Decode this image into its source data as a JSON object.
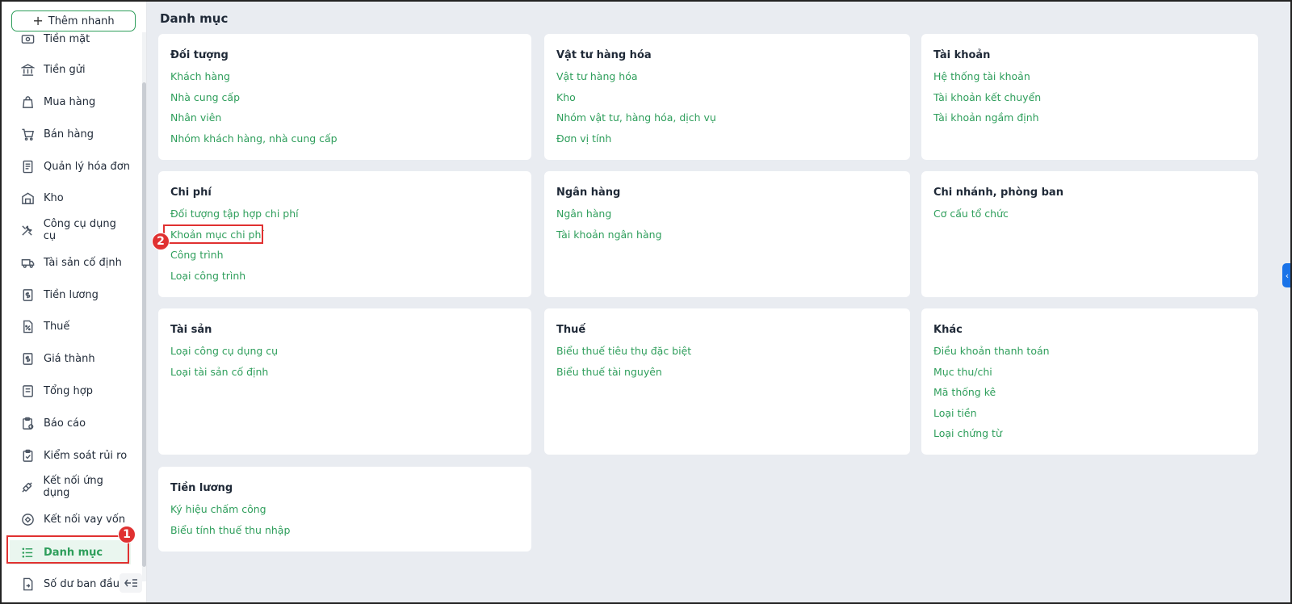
{
  "sidebar": {
    "quick_add_label": "Thêm nhanh",
    "items": [
      {
        "label": "Tiền mặt",
        "icon": "cash-icon"
      },
      {
        "label": "Tiền gửi",
        "icon": "bank-icon"
      },
      {
        "label": "Mua hàng",
        "icon": "bag-icon"
      },
      {
        "label": "Bán hàng",
        "icon": "cart-icon"
      },
      {
        "label": "Quản lý hóa đơn",
        "icon": "invoice-icon"
      },
      {
        "label": "Kho",
        "icon": "warehouse-icon"
      },
      {
        "label": "Công cụ dụng cụ",
        "icon": "tools-icon"
      },
      {
        "label": "Tài sản cố định",
        "icon": "truck-icon"
      },
      {
        "label": "Tiền lương",
        "icon": "salary-icon"
      },
      {
        "label": "Thuế",
        "icon": "tax-icon"
      },
      {
        "label": "Giá thành",
        "icon": "cost-icon"
      },
      {
        "label": "Tổng hợp",
        "icon": "summary-icon"
      },
      {
        "label": "Báo cáo",
        "icon": "report-icon"
      },
      {
        "label": "Kiểm soát rủi ro",
        "icon": "risk-icon"
      },
      {
        "label": "Kết nối ứng dụng",
        "icon": "connect-icon"
      },
      {
        "label": "Kết nối vay vốn",
        "icon": "loan-icon"
      },
      {
        "label": "Danh mục",
        "icon": "list-icon",
        "active": true
      },
      {
        "label": "Số dư ban đầu",
        "icon": "balance-icon"
      }
    ]
  },
  "main": {
    "title": "Danh mục",
    "cards": [
      {
        "title": "Đối tượng",
        "links": [
          "Khách hàng",
          "Nhà cung cấp",
          "Nhân viên",
          "Nhóm khách hàng, nhà cung cấp"
        ]
      },
      {
        "title": "Vật tư hàng hóa",
        "links": [
          "Vật tư hàng hóa",
          "Kho",
          "Nhóm vật tư, hàng hóa, dịch vụ",
          "Đơn vị tính"
        ]
      },
      {
        "title": "Tài khoản",
        "links": [
          "Hệ thống tài khoản",
          "Tài khoản kết chuyển",
          "Tài khoản ngầm định"
        ]
      },
      {
        "title": "Chi phí",
        "links": [
          "Đối tượng tập hợp chi phí",
          "Khoản mục chi phí",
          "Công trình",
          "Loại công trình"
        ]
      },
      {
        "title": "Ngân hàng",
        "links": [
          "Ngân hàng",
          "Tài khoản ngân hàng"
        ]
      },
      {
        "title": "Chi nhánh, phòng ban",
        "links": [
          "Cơ cấu tổ chức"
        ]
      },
      {
        "title": "Tài sản",
        "links": [
          "Loại công cụ dụng cụ",
          "Loại tài sản cố định"
        ]
      },
      {
        "title": "Thuế",
        "links": [
          "Biểu thuế tiêu thụ đặc biệt",
          "Biểu thuế tài nguyên"
        ]
      },
      {
        "title": "Khác",
        "links": [
          "Điều khoản thanh toán",
          "Mục thu/chi",
          "Mã thống kê",
          "Loại tiền",
          "Loại chứng từ"
        ]
      },
      {
        "title": "Tiền lương",
        "links": [
          "Ký hiệu chấm công",
          "Biểu tính thuế thu nhập"
        ]
      }
    ]
  },
  "annotations": {
    "step1": "1",
    "step2": "2",
    "color": "#e03131"
  },
  "colors": {
    "accent": "#2e9e5b",
    "background": "#e9ecf1"
  }
}
